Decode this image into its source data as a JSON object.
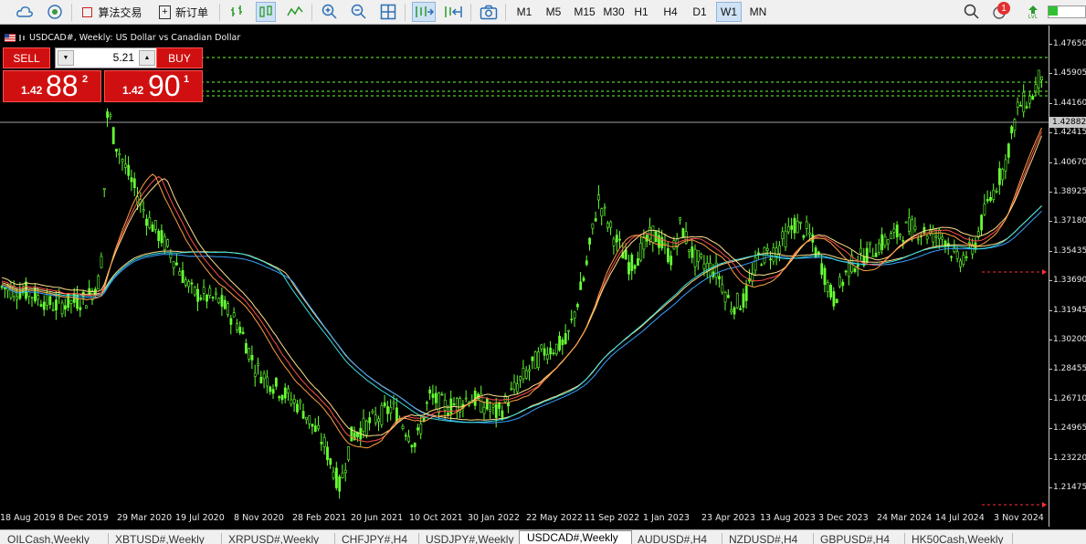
{
  "toolbar": {
    "algo_trading_label": "算法交易",
    "new_order_label": "新订单",
    "timeframes": [
      "M1",
      "M5",
      "M15",
      "M30",
      "H1",
      "H4",
      "D1",
      "W1",
      "MN"
    ],
    "active_timeframe": "W1",
    "notification_count": "1",
    "icons": [
      "cloud-icon",
      "signal-icon",
      "stop-icon",
      "add-order-icon",
      "bar-chart-icon",
      "candle-chart-icon",
      "line-chart-icon",
      "zoom-in-icon",
      "zoom-out-icon",
      "grid-icon",
      "autoscroll-icon",
      "chart-shift-icon",
      "screenshot-icon",
      "search-icon",
      "notification-icon",
      "account-icon",
      "level-icon"
    ],
    "level_label": "LVL"
  },
  "chart": {
    "title": "USDCAD#, Weekly:  US Dollar vs Canadian Dollar",
    "background": "#000000",
    "candle_color": "#66ff33",
    "current_price": "1.42882",
    "price_labels": [
      "1.47650",
      "1.45905",
      "1.44160",
      "1.42415",
      "1.40670",
      "1.38925",
      "1.37180",
      "1.35435",
      "1.33690",
      "1.31945",
      "1.30200",
      "1.28455",
      "1.26710",
      "1.24965",
      "1.23220",
      "1.21475"
    ],
    "time_labels": [
      "18 Aug 2019",
      "8 Dec 2019",
      "29 Mar 2020",
      "19 Jul 2020",
      "8 Nov 2020",
      "28 Feb 2021",
      "20 Jun 2021",
      "10 Oct 2021",
      "30 Jan 2022",
      "22 May 2022",
      "11 Sep 2022",
      "1 Jan 2023",
      "23 Apr 2023",
      "13 Aug 2023",
      "3 Dec 2023",
      "24 Mar 2024",
      "14 Jul 2024",
      "3 Nov 2024"
    ]
  },
  "trade_panel": {
    "sell_label": "SELL",
    "buy_label": "BUY",
    "volume": "5.21",
    "sell_prefix": "1.42",
    "sell_big": "88",
    "sell_sup": "2",
    "buy_prefix": "1.42",
    "buy_big": "90",
    "buy_sup": "1",
    "color": "#d01010"
  },
  "tabs": [
    "OILCash,Weekly",
    "XBTUSD#,Weekly",
    "XRPUSD#,Weekly",
    "CHFJPY#,H4",
    "USDJPY#,Weekly",
    "USDCAD#,Weekly",
    "AUDUSD#,H4",
    "NZDUSD#,H4",
    "GBPUSD#,H4",
    "HK50Cash,Weekly"
  ],
  "active_tab": "USDCAD#,Weekly"
}
